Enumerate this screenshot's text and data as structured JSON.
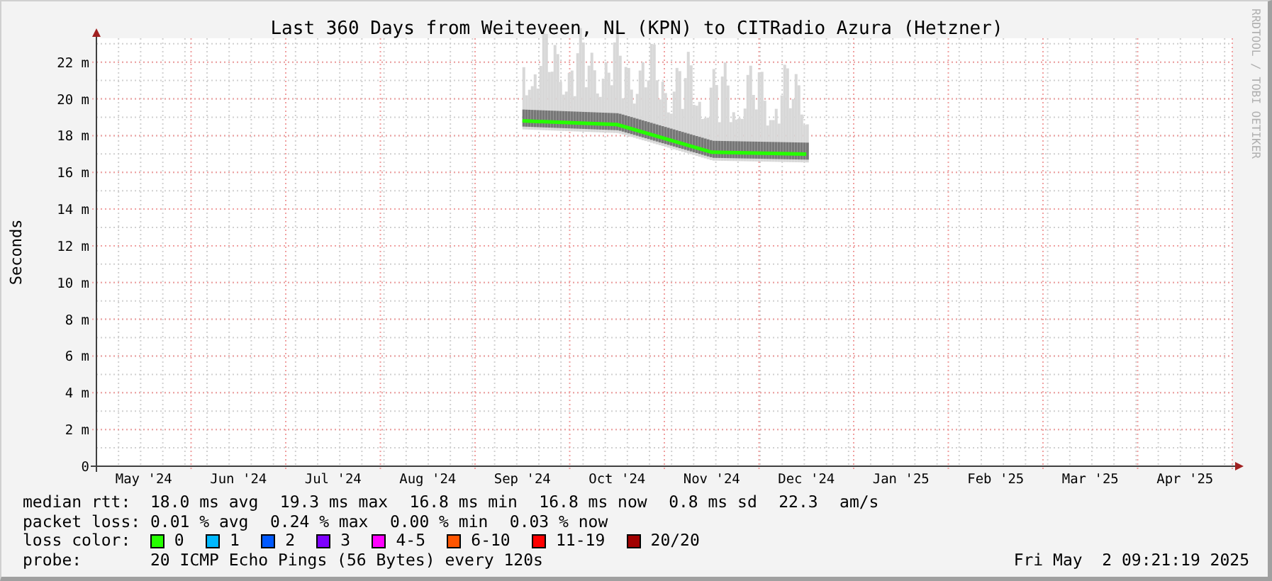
{
  "graph": {
    "title": "Last 360 Days from Weiteveen, NL (KPN) to CITRadio Azura (Hetzner)",
    "credit": "RRDTOOL / TOBI OETIKER",
    "chart_data": {
      "type": "line",
      "grid": true,
      "ylabel": "Seconds",
      "ylim": [
        0,
        23.3
      ],
      "yticks": [
        {
          "value": 0,
          "label": "0"
        },
        {
          "value": 2,
          "label": "2 m"
        },
        {
          "value": 4,
          "label": "4 m"
        },
        {
          "value": 6,
          "label": "6 m"
        },
        {
          "value": 8,
          "label": "8 m"
        },
        {
          "value": 10,
          "label": "10 m"
        },
        {
          "value": 12,
          "label": "12 m"
        },
        {
          "value": 14,
          "label": "14 m"
        },
        {
          "value": 16,
          "label": "16 m"
        },
        {
          "value": 18,
          "label": "18 m"
        },
        {
          "value": 20,
          "label": "20 m"
        },
        {
          "value": 22,
          "label": "22 m"
        }
      ],
      "categories": [
        "May '24",
        "Jun '24",
        "Jul '24",
        "Aug '24",
        "Sep '24",
        "Oct '24",
        "Nov '24",
        "Dec '24",
        "Jan '25",
        "Feb '25",
        "Mar '25",
        "Apr '25"
      ],
      "series": [
        {
          "color": "#26ff00",
          "values": [
            null,
            null,
            null,
            null,
            18.8,
            18.6,
            17.1,
            17.0,
            null,
            null,
            null,
            null
          ]
        }
      ]
    }
  },
  "legend": {
    "median_rtt": {
      "label": "median rtt:",
      "items": [
        "18.0 ms avg",
        "19.3 ms max",
        "16.8 ms min",
        "16.8 ms now",
        "0.8 ms sd",
        "22.3",
        "am/s"
      ]
    },
    "packet_loss": {
      "label": "packet loss:",
      "items": [
        "0.01 % avg",
        "0.24 % max",
        "0.00 % min",
        "0.03 % now"
      ]
    },
    "loss_color": {
      "label": "loss color:",
      "items": [
        {
          "label": "0",
          "color": "#26ff00"
        },
        {
          "label": "1",
          "color": "#00b8ff"
        },
        {
          "label": "2",
          "color": "#0059ff"
        },
        {
          "label": "3",
          "color": "#7e00ff"
        },
        {
          "label": "4-5",
          "color": "#ff00ff"
        },
        {
          "label": "6-10",
          "color": "#ff5500"
        },
        {
          "label": "11-19",
          "color": "#ff0000"
        },
        {
          "label": "20/20",
          "color": "#a10000"
        }
      ]
    },
    "probe": {
      "label": "probe:",
      "text": "20 ICMP Echo Pings (56 Bytes) every 120s"
    },
    "timestamp": "Fri May  2 09:21:19 2025"
  }
}
